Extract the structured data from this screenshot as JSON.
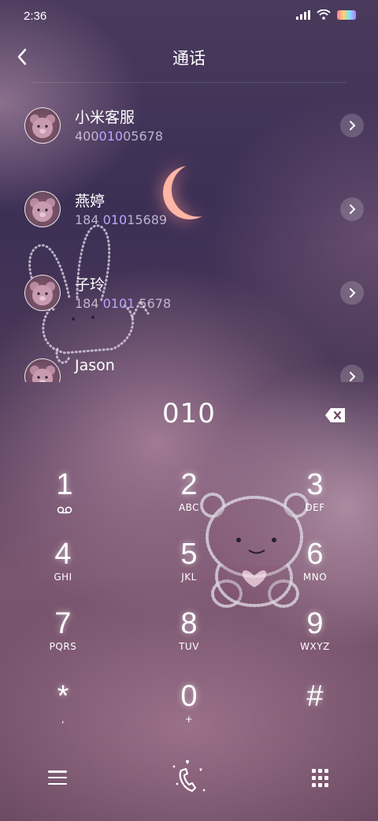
{
  "status": {
    "time": "2:36",
    "icons": [
      "signal-icon",
      "wifi-icon",
      "battery-icon"
    ]
  },
  "header": {
    "title": "通话",
    "back_icon": "back-arrow-icon"
  },
  "contacts": [
    {
      "name": "小米客服",
      "number_pre": "400",
      "number_hl": "010",
      "number_post": "05678"
    },
    {
      "name": "燕婷",
      "number_pre": "184 ",
      "number_hl": "010",
      "number_post": "15689"
    },
    {
      "name": "子玲",
      "number_pre": "184 ",
      "number_hl": "0101",
      "number_post": " 5678"
    },
    {
      "name": "Jason",
      "number_pre": "",
      "number_hl": "",
      "number_post": ""
    }
  ],
  "dialer": {
    "input": "010"
  },
  "keypad": [
    {
      "digit": "1",
      "letters": ""
    },
    {
      "digit": "2",
      "letters": "ABC"
    },
    {
      "digit": "3",
      "letters": "DEF"
    },
    {
      "digit": "4",
      "letters": "GHI"
    },
    {
      "digit": "5",
      "letters": "JKL"
    },
    {
      "digit": "6",
      "letters": "MNO"
    },
    {
      "digit": "7",
      "letters": "PQRS"
    },
    {
      "digit": "8",
      "letters": "TUV"
    },
    {
      "digit": "9",
      "letters": "WXYZ"
    },
    {
      "digit": "*",
      "letters": ","
    },
    {
      "digit": "0",
      "letters": "+"
    },
    {
      "digit": "#",
      "letters": ""
    }
  ],
  "colors": {
    "highlight": "#b9a6ff",
    "moon": "#ffb5a5"
  }
}
